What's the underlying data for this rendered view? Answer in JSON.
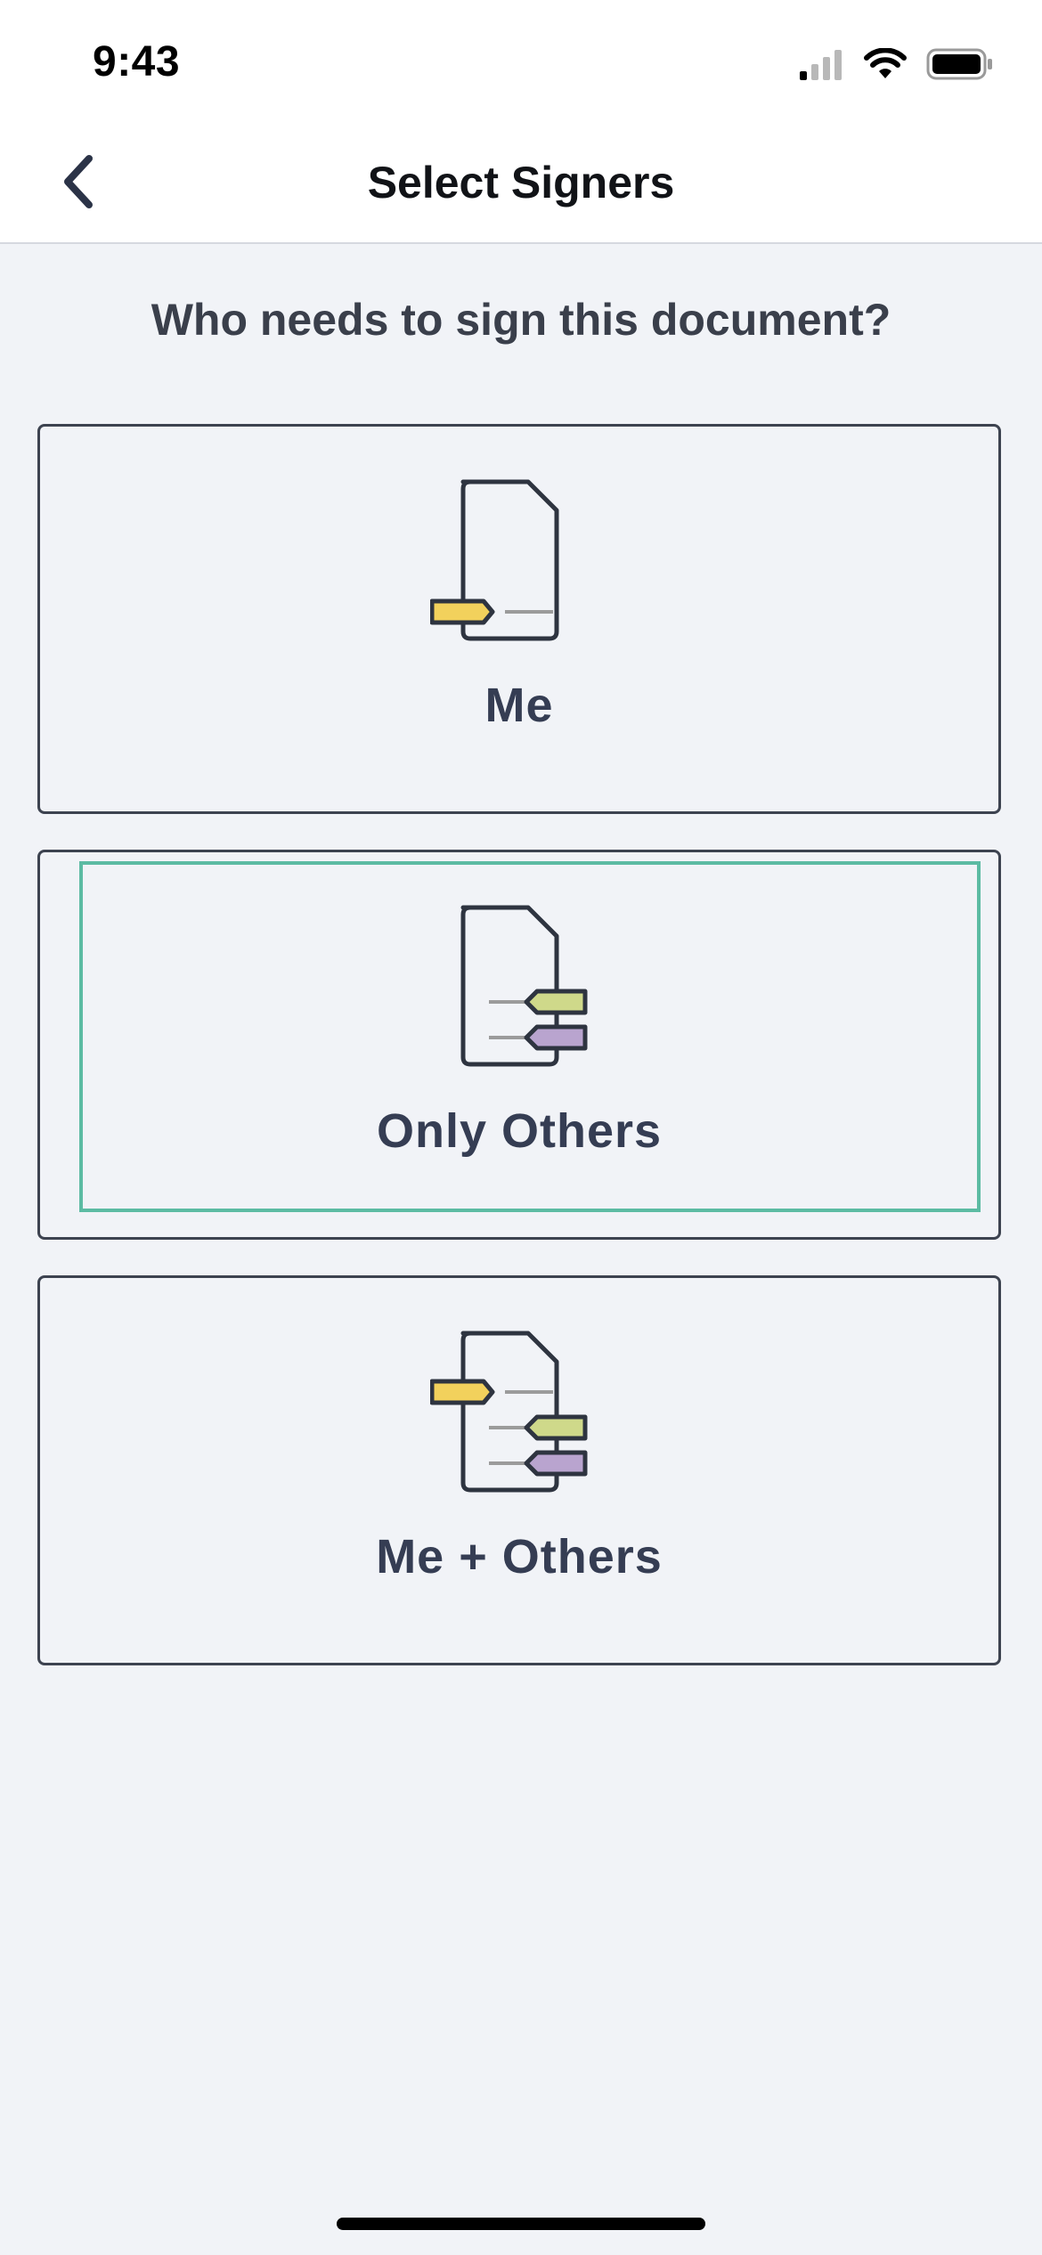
{
  "status_bar": {
    "time": "9:43",
    "icons": [
      "cellular-signal-icon",
      "wifi-icon",
      "battery-icon"
    ]
  },
  "nav": {
    "title": "Select Signers",
    "back_icon": "chevron-left-icon"
  },
  "prompt": "Who needs to sign this document?",
  "options": [
    {
      "label": "Me",
      "icon": "document-me-icon",
      "focused": false
    },
    {
      "label": "Only Others",
      "icon": "document-others-icon",
      "focused": true
    },
    {
      "label": "Me + Others",
      "icon": "document-me-others-icon",
      "focused": false
    }
  ],
  "colors": {
    "background": "#f1f3f7",
    "text_dark": "#353d53",
    "focus_ring": "#5cbba3",
    "tag_me": "#f2d15c",
    "tag_other_1": "#cfd98a",
    "tag_other_2": "#b9a4cf"
  }
}
